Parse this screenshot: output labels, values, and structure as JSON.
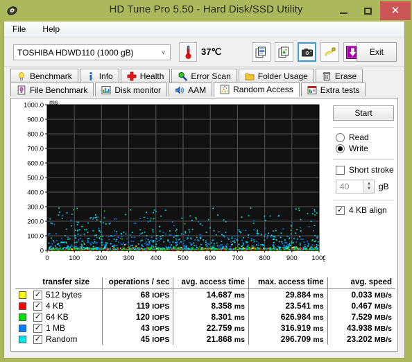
{
  "window": {
    "title": "HD Tune Pro 5.50 - Hard Disk/SSD Utility",
    "app_icon": "hard-disk-icon",
    "minimize": "–",
    "maximize": "□",
    "close": "✕",
    "frame_color": "#abb85c",
    "close_color": "#cc5555"
  },
  "menu": [
    {
      "label": "File"
    },
    {
      "label": "Help"
    }
  ],
  "toolbar": {
    "drive": {
      "value": "TOSHIBA HDWD110 (1000 gB)",
      "arrow": "˅"
    },
    "temperature": {
      "icon": "thermometer-icon",
      "value": "37℃"
    },
    "buttons": [
      {
        "name": "copy-text-icon",
        "title": "Copy text"
      },
      {
        "name": "copy-image-icon",
        "title": "Copy image"
      },
      {
        "name": "screenshot-camera-icon",
        "title": "Screenshot",
        "focused": true
      },
      {
        "name": "cable-key-icon",
        "title": "Options"
      },
      {
        "name": "save-download-icon",
        "title": "Save"
      }
    ],
    "exit_label": "Exit"
  },
  "tabs": {
    "row1": [
      {
        "label": "Benchmark",
        "icon": "lightbulb-icon",
        "active": false
      },
      {
        "label": "Info",
        "icon": "info-icon",
        "active": false
      },
      {
        "label": "Health",
        "icon": "red-cross-icon",
        "active": false
      },
      {
        "label": "Error Scan",
        "icon": "magnifier-icon",
        "active": false
      },
      {
        "label": "Folder Usage",
        "icon": "folder-icon",
        "active": false
      },
      {
        "label": "Erase",
        "icon": "trash-icon",
        "active": false
      }
    ],
    "row2": [
      {
        "label": "File Benchmark",
        "icon": "file-benchmark-icon",
        "active": false
      },
      {
        "label": "Disk monitor",
        "icon": "bar-chart-icon",
        "active": false
      },
      {
        "label": "AAM",
        "icon": "speaker-icon",
        "active": false
      },
      {
        "label": "Random Access",
        "icon": "scatter-icon",
        "active": true
      },
      {
        "label": "Extra tests",
        "icon": "extra-tests-icon",
        "active": false
      }
    ]
  },
  "controls": {
    "start_label": "Start",
    "mode": {
      "options": [
        {
          "label": "Read",
          "selected": false
        },
        {
          "label": "Write",
          "selected": true
        }
      ]
    },
    "short_stroke": {
      "label": "Short stroke",
      "checked": false
    },
    "short_stroke_value": "40",
    "short_stroke_unit": "gB",
    "align": {
      "label": "4 KB align",
      "checked": true
    }
  },
  "results": {
    "columns": [
      "transfer size",
      "operations / sec",
      "avg. access time",
      "max. access time",
      "avg. speed"
    ],
    "rows": [
      {
        "color": "#ffff00",
        "checked": true,
        "name": "512 bytes",
        "iops": "68",
        "iops_unit": "IOPS",
        "avg": "14.687",
        "avg_unit": "ms",
        "max": "29.884",
        "max_unit": "ms",
        "speed": "0.033",
        "speed_unit": "MB/s"
      },
      {
        "color": "#ff0000",
        "checked": true,
        "name": "4 KB",
        "iops": "119",
        "iops_unit": "IOPS",
        "avg": "8.358",
        "avg_unit": "ms",
        "max": "23.541",
        "max_unit": "ms",
        "speed": "0.467",
        "speed_unit": "MB/s"
      },
      {
        "color": "#00e000",
        "checked": true,
        "name": "64 KB",
        "iops": "120",
        "iops_unit": "IOPS",
        "avg": "8.301",
        "avg_unit": "ms",
        "max": "626.984",
        "max_unit": "ms",
        "speed": "7.529",
        "speed_unit": "MB/s"
      },
      {
        "color": "#0080ff",
        "checked": true,
        "name": "1 MB",
        "iops": "43",
        "iops_unit": "IOPS",
        "avg": "22.759",
        "avg_unit": "ms",
        "max": "316.919",
        "max_unit": "ms",
        "speed": "43.938",
        "speed_unit": "MB/s"
      },
      {
        "color": "#00e5ee",
        "checked": true,
        "name": "Random",
        "iops": "45",
        "iops_unit": "IOPS",
        "avg": "21.868",
        "avg_unit": "ms",
        "max": "296.709",
        "max_unit": "ms",
        "speed": "23.202",
        "speed_unit": "MB/s"
      }
    ]
  },
  "chart_data": {
    "type": "scatter",
    "title": "",
    "xlabel": "gB",
    "ylabel": "ms",
    "xlim": [
      0,
      1000
    ],
    "ylim": [
      0,
      1000
    ],
    "xticks": [
      0,
      100,
      200,
      300,
      400,
      500,
      600,
      700,
      800,
      900,
      1000
    ],
    "yticks": [
      0,
      100.0,
      200.0,
      300.0,
      400.0,
      500.0,
      600.0,
      700.0,
      800.0,
      900.0,
      1000.0
    ],
    "ytick_labels": [
      "0",
      "100.0",
      "200.0",
      "300.0",
      "400.0",
      "500.0",
      "600.0",
      "700.0",
      "800.0",
      "900.0",
      "1000.0"
    ],
    "grid": true,
    "background": "#111111",
    "grid_color": "#585858",
    "axis_text_color": "#000000",
    "legend_position": "table-below",
    "series": [
      {
        "name": "512 bytes",
        "color": "#ffff00",
        "points": 420,
        "band_low": 2,
        "band_high": 22,
        "outlier_rate": 0.01,
        "outlier_max": 60
      },
      {
        "name": "4 KB",
        "color": "#ff0000",
        "points": 420,
        "band_low": 2,
        "band_high": 18,
        "outlier_rate": 0.01,
        "outlier_max": 50
      },
      {
        "name": "64 KB",
        "color": "#00e000",
        "points": 380,
        "band_low": 3,
        "band_high": 24,
        "outlier_rate": 0.035,
        "outlier_max": 300
      },
      {
        "name": "1 MB",
        "color": "#0080ff",
        "points": 360,
        "band_low": 10,
        "band_high": 120,
        "outlier_rate": 0.1,
        "outlier_max": 250
      },
      {
        "name": "Random",
        "color": "#00e5ee",
        "points": 430,
        "band_low": 6,
        "band_high": 150,
        "outlier_rate": 0.14,
        "outlier_max": 300
      }
    ]
  }
}
